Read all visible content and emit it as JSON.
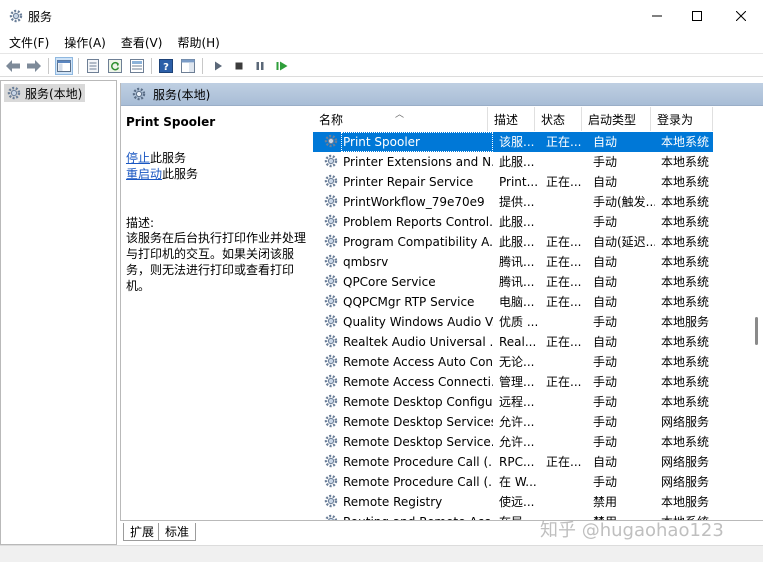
{
  "window": {
    "title": "服务",
    "icon": "gear-icon"
  },
  "menu": [
    "文件(F)",
    "操作(A)",
    "查看(V)",
    "帮助(H)"
  ],
  "tree": {
    "root_label": "服务(本地)"
  },
  "panel": {
    "header": "服务(本地)"
  },
  "detail": {
    "service_name": "Print Spooler",
    "stop_link": "停止",
    "stop_suffix": "此服务",
    "restart_link": "重启动",
    "restart_suffix": "此服务",
    "desc_label": "描述:",
    "desc_text": "该服务在后台执行打印作业并处理与打印机的交互。如果关闭该服务，则无法进行打印或查看打印机。"
  },
  "table": {
    "columns": [
      "名称",
      "描述",
      "状态",
      "启动类型",
      "登录为"
    ],
    "rows": [
      {
        "name": "Print Spooler",
        "desc": "该服...",
        "status": "正在...",
        "startup": "自动",
        "logon": "本地系统",
        "selected": true
      },
      {
        "name": "Printer Extensions and N...",
        "desc": "此服...",
        "status": "",
        "startup": "手动",
        "logon": "本地系统"
      },
      {
        "name": "Printer Repair Service",
        "desc": "Print...",
        "status": "正在...",
        "startup": "自动",
        "logon": "本地系统"
      },
      {
        "name": "PrintWorkflow_79e70e9",
        "desc": "提供...",
        "status": "",
        "startup": "手动(触发...",
        "logon": "本地系统"
      },
      {
        "name": "Problem Reports Control...",
        "desc": "此服...",
        "status": "",
        "startup": "手动",
        "logon": "本地系统"
      },
      {
        "name": "Program Compatibility A...",
        "desc": "此服...",
        "status": "正在...",
        "startup": "自动(延迟...",
        "logon": "本地系统"
      },
      {
        "name": "qmbsrv",
        "desc": "腾讯...",
        "status": "正在...",
        "startup": "自动",
        "logon": "本地系统"
      },
      {
        "name": "QPCore Service",
        "desc": "腾讯...",
        "status": "正在...",
        "startup": "自动",
        "logon": "本地系统"
      },
      {
        "name": "QQPCMgr RTP Service",
        "desc": "电脑...",
        "status": "正在...",
        "startup": "自动",
        "logon": "本地系统"
      },
      {
        "name": "Quality Windows Audio V...",
        "desc": "优质 ...",
        "status": "",
        "startup": "手动",
        "logon": "本地服务"
      },
      {
        "name": "Realtek Audio Universal ...",
        "desc": "Real...",
        "status": "正在...",
        "startup": "自动",
        "logon": "本地系统"
      },
      {
        "name": "Remote Access Auto Con...",
        "desc": "无论...",
        "status": "",
        "startup": "手动",
        "logon": "本地系统"
      },
      {
        "name": "Remote Access Connecti...",
        "desc": "管理...",
        "status": "正在...",
        "startup": "手动",
        "logon": "本地系统"
      },
      {
        "name": "Remote Desktop Configu...",
        "desc": "远程...",
        "status": "",
        "startup": "手动",
        "logon": "本地系统"
      },
      {
        "name": "Remote Desktop Services",
        "desc": "允许...",
        "status": "",
        "startup": "手动",
        "logon": "网络服务"
      },
      {
        "name": "Remote Desktop Service...",
        "desc": "允许...",
        "status": "",
        "startup": "手动",
        "logon": "本地系统"
      },
      {
        "name": "Remote Procedure Call (...",
        "desc": "RPC...",
        "status": "正在...",
        "startup": "自动",
        "logon": "网络服务"
      },
      {
        "name": "Remote Procedure Call (...",
        "desc": "在 W...",
        "status": "",
        "startup": "手动",
        "logon": "网络服务"
      },
      {
        "name": "Remote Registry",
        "desc": "使远...",
        "status": "",
        "startup": "禁用",
        "logon": "本地服务"
      },
      {
        "name": "Routing and Remote Acc...",
        "desc": "在局...",
        "status": "",
        "startup": "禁用",
        "logon": "本地系统"
      }
    ]
  },
  "tabs": [
    "扩展",
    "标准"
  ],
  "watermark": "知乎 @hugaohao123"
}
